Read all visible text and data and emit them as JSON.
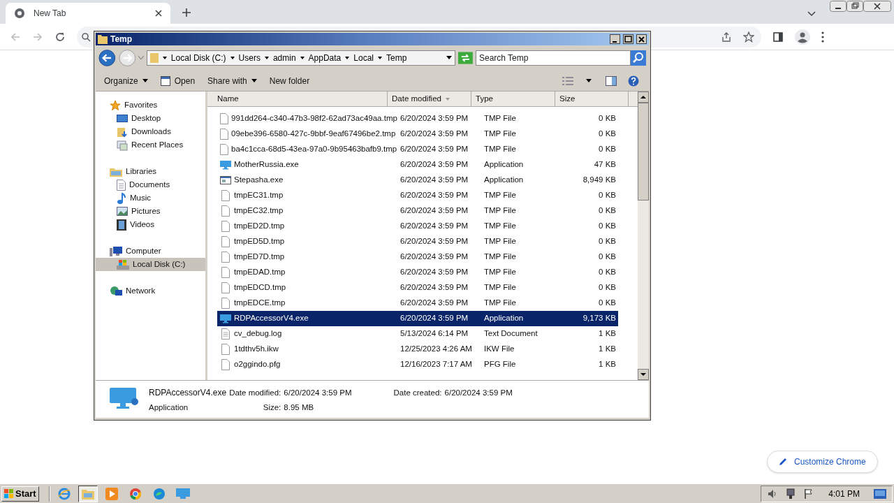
{
  "browser": {
    "tab": {
      "title": "New Tab",
      "selected": true
    },
    "customize_button": "Customize Chrome"
  },
  "explorer": {
    "title": "Temp",
    "breadcrumb": [
      "Local Disk (C:)",
      "Users",
      "admin",
      "AppData",
      "Local",
      "Temp"
    ],
    "search": {
      "placeholder": "Search Temp"
    },
    "toolbar": [
      {
        "label": "Organize",
        "kind": "menu"
      },
      {
        "label": "Open",
        "kind": "open"
      },
      {
        "label": "Share with",
        "kind": "menu"
      },
      {
        "label": "New folder",
        "kind": "plain"
      }
    ],
    "sidebar": [
      {
        "label": "Favorites",
        "kind": "star",
        "selected": false,
        "children": [
          {
            "label": "Desktop",
            "kind": "desktop",
            "selected": false
          },
          {
            "label": "Downloads",
            "kind": "downloads",
            "selected": false
          },
          {
            "label": "Recent Places",
            "kind": "recent",
            "selected": false
          }
        ]
      },
      {
        "label": "Libraries",
        "kind": "library",
        "selected": false,
        "children": [
          {
            "label": "Documents",
            "kind": "document",
            "selected": false
          },
          {
            "label": "Music",
            "kind": "music",
            "selected": false
          },
          {
            "label": "Pictures",
            "kind": "pictures",
            "selected": false
          },
          {
            "label": "Videos",
            "kind": "videos",
            "selected": false
          }
        ]
      },
      {
        "label": "Computer",
        "kind": "computer",
        "selected": false,
        "children": [
          {
            "label": "Local Disk (C:)",
            "kind": "disk",
            "selected": true
          }
        ]
      },
      {
        "label": "Network",
        "kind": "network",
        "selected": false
      }
    ],
    "columns": [
      "Name",
      "Date modified",
      "Type",
      "Size"
    ],
    "files": [
      {
        "name": "991dd264-c340-47b3-98f2-62ad73ac49aa.tmp",
        "date": "6/20/2024 3:59 PM",
        "type": "TMP File",
        "size": "0 KB",
        "kind": "file",
        "selected": false
      },
      {
        "name": "09ebe396-6580-427c-9bbf-9eaf67496be2.tmp",
        "date": "6/20/2024 3:59 PM",
        "type": "TMP File",
        "size": "0 KB",
        "kind": "file",
        "selected": false
      },
      {
        "name": "ba4c1cca-68d5-43ea-97a0-9b95463bafb9.tmp",
        "date": "6/20/2024 3:59 PM",
        "type": "TMP File",
        "size": "0 KB",
        "kind": "file",
        "selected": false
      },
      {
        "name": "MotherRussia.exe",
        "date": "6/20/2024 3:59 PM",
        "type": "Application",
        "size": "47 KB",
        "kind": "monitor",
        "selected": false
      },
      {
        "name": "Stepasha.exe",
        "date": "6/20/2024 3:59 PM",
        "type": "Application",
        "size": "8,949 KB",
        "kind": "window",
        "selected": false
      },
      {
        "name": "tmpEC31.tmp",
        "date": "6/20/2024 3:59 PM",
        "type": "TMP File",
        "size": "0 KB",
        "kind": "file",
        "selected": false
      },
      {
        "name": "tmpEC32.tmp",
        "date": "6/20/2024 3:59 PM",
        "type": "TMP File",
        "size": "0 KB",
        "kind": "file",
        "selected": false
      },
      {
        "name": "tmpED2D.tmp",
        "date": "6/20/2024 3:59 PM",
        "type": "TMP File",
        "size": "0 KB",
        "kind": "file",
        "selected": false
      },
      {
        "name": "tmpED5D.tmp",
        "date": "6/20/2024 3:59 PM",
        "type": "TMP File",
        "size": "0 KB",
        "kind": "file",
        "selected": false
      },
      {
        "name": "tmpED7D.tmp",
        "date": "6/20/2024 3:59 PM",
        "type": "TMP File",
        "size": "0 KB",
        "kind": "file",
        "selected": false
      },
      {
        "name": "tmpEDAD.tmp",
        "date": "6/20/2024 3:59 PM",
        "type": "TMP File",
        "size": "0 KB",
        "kind": "file",
        "selected": false
      },
      {
        "name": "tmpEDCD.tmp",
        "date": "6/20/2024 3:59 PM",
        "type": "TMP File",
        "size": "0 KB",
        "kind": "file",
        "selected": false
      },
      {
        "name": "tmpEDCE.tmp",
        "date": "6/20/2024 3:59 PM",
        "type": "TMP File",
        "size": "0 KB",
        "kind": "file",
        "selected": false
      },
      {
        "name": "RDPAccessorV4.exe",
        "date": "6/20/2024 3:59 PM",
        "type": "Application",
        "size": "9,173 KB",
        "kind": "monitor",
        "selected": true
      },
      {
        "name": "cv_debug.log",
        "date": "5/13/2024 6:14 PM",
        "type": "Text Document",
        "size": "1 KB",
        "kind": "text",
        "selected": false
      },
      {
        "name": "1tdthv5h.ikw",
        "date": "12/25/2023 4:26 AM",
        "type": "IKW File",
        "size": "1 KB",
        "kind": "file",
        "selected": false
      },
      {
        "name": "o2ggindo.pfg",
        "date": "12/16/2023 7:17 AM",
        "type": "PFG File",
        "size": "1 KB",
        "kind": "file",
        "selected": false
      }
    ],
    "details": {
      "name": "RDPAccessorV4.exe",
      "type": "Application",
      "modified_label": "Date modified:",
      "modified": "6/20/2024 3:59 PM",
      "size_label": "Size:",
      "size": "8.95 MB",
      "created_label": "Date created:",
      "created": "6/20/2024 3:59 PM"
    }
  },
  "taskbar": {
    "start": "Start",
    "apps": [
      {
        "kind": "ie",
        "selected": false
      },
      {
        "kind": "explorer",
        "selected": true
      },
      {
        "kind": "media",
        "selected": false
      },
      {
        "kind": "chrome",
        "selected": false
      },
      {
        "kind": "edge",
        "selected": false
      },
      {
        "kind": "monitor",
        "selected": false
      }
    ],
    "clock": "4:01 PM"
  }
}
